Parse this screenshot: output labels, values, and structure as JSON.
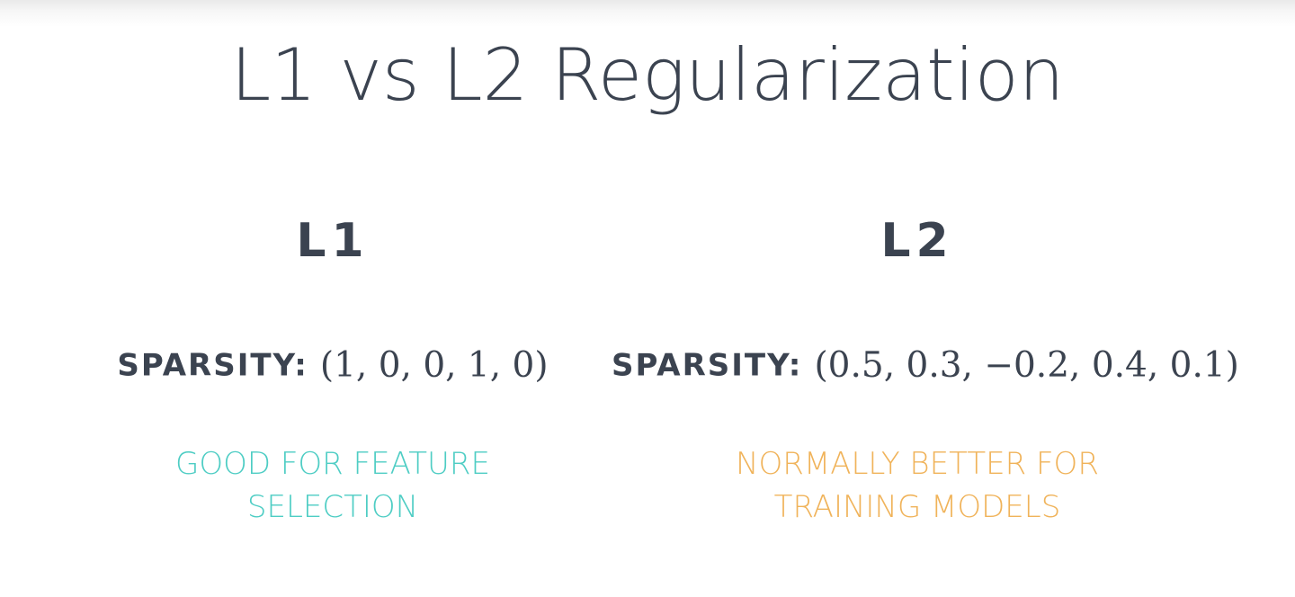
{
  "slide": {
    "title": "L1 vs L2 Regularization"
  },
  "columns": [
    {
      "heading": "L1",
      "sparsity_label": "SPARSITY:",
      "sparsity_vector": "(1, 0, 0, 1, 0)",
      "note_lines": [
        "GOOD FOR FEATURE",
        "SELECTION"
      ],
      "note_color": "#4ecdc4"
    },
    {
      "heading": "L2",
      "sparsity_label": "SPARSITY:",
      "sparsity_vector": "(0.5, 0.3, −0.2, 0.4, 0.1)",
      "note_lines": [
        "NORMALLY BETTER FOR",
        "TRAINING MODELS"
      ],
      "note_color": "#f0b35a"
    }
  ],
  "colors": {
    "text": "#3b4350",
    "background": "#ffffff"
  }
}
